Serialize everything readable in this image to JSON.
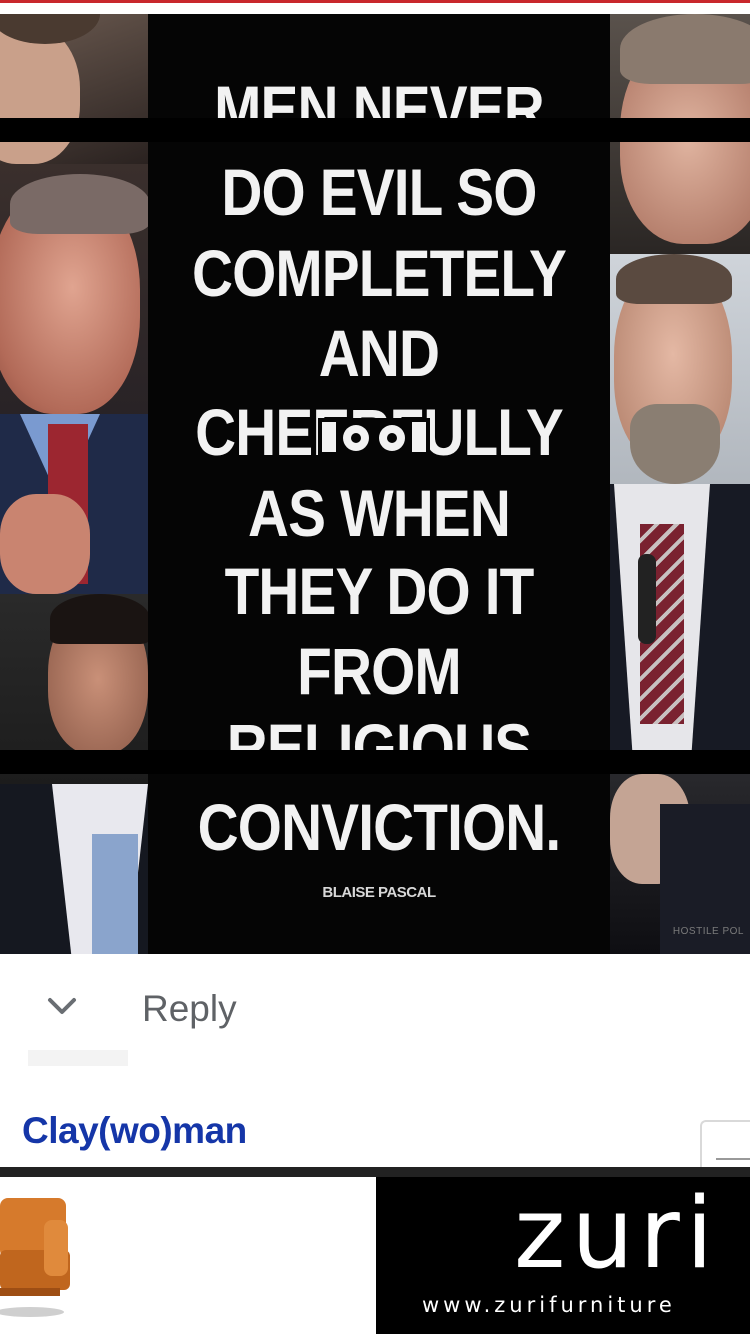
{
  "meme": {
    "quote_lines": [
      "MEN NEVER",
      "DO  EVIL SO",
      "COMPLETELY",
      "AND",
      "CHEERFULLY",
      "AS WHEN",
      "THEY DO IT",
      "FROM",
      "RELIGIOUS",
      "CONVICTION."
    ],
    "attribution": "BLAISE PASCAL",
    "watermark": "HOSTILE POL"
  },
  "comment": {
    "reply_label": "Reply",
    "username": "Clay(wo)man"
  },
  "ad": {
    "brand": "zuri",
    "url": "www.zurifurniture"
  },
  "colors": {
    "username": "#1536a8",
    "reply_text": "#5f6266",
    "top_accent": "#c9272c",
    "meme_background": "#050505"
  }
}
